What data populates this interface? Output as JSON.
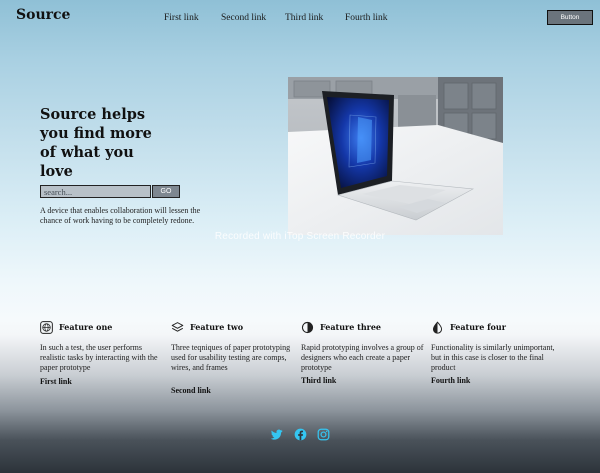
{
  "header": {
    "logo": "Source",
    "nav": [
      "First link",
      "Second link",
      "Third link",
      "Fourth link"
    ],
    "button_label": "Button"
  },
  "hero": {
    "title": "Source helps you find more of what you love",
    "search": {
      "placeholder": "search...",
      "value": ""
    },
    "go_label": "GO",
    "description": "A device that enables collaboration will lessen the chance of work having to be completely redone."
  },
  "watermark": "Recorded with iTop Screen Recorder",
  "features": [
    {
      "title": "Feature one",
      "icon": "globe-icon",
      "description": "In such a test, the user performs realistic tasks by interacting with the paper prototype",
      "link": "First link"
    },
    {
      "title": "Feature two",
      "icon": "layers-icon",
      "description": "Three teqniques of paper prototyping used for usability testing are comps, wires, and frames",
      "link": "Second link"
    },
    {
      "title": "Feature three",
      "icon": "contrast-icon",
      "description": "Rapid prototyping involves a group of designers who each create a paper prototype",
      "link": "Third link"
    },
    {
      "title": "Feature four",
      "icon": "droplet-half-icon",
      "description": "Functionality is similarly unimportant, but in this case is closer to the final product",
      "link": "Fourth link"
    }
  ],
  "footer": {
    "social": [
      "twitter-icon",
      "facebook-icon",
      "instagram-icon"
    ],
    "accent_color": "#34c6f2"
  }
}
